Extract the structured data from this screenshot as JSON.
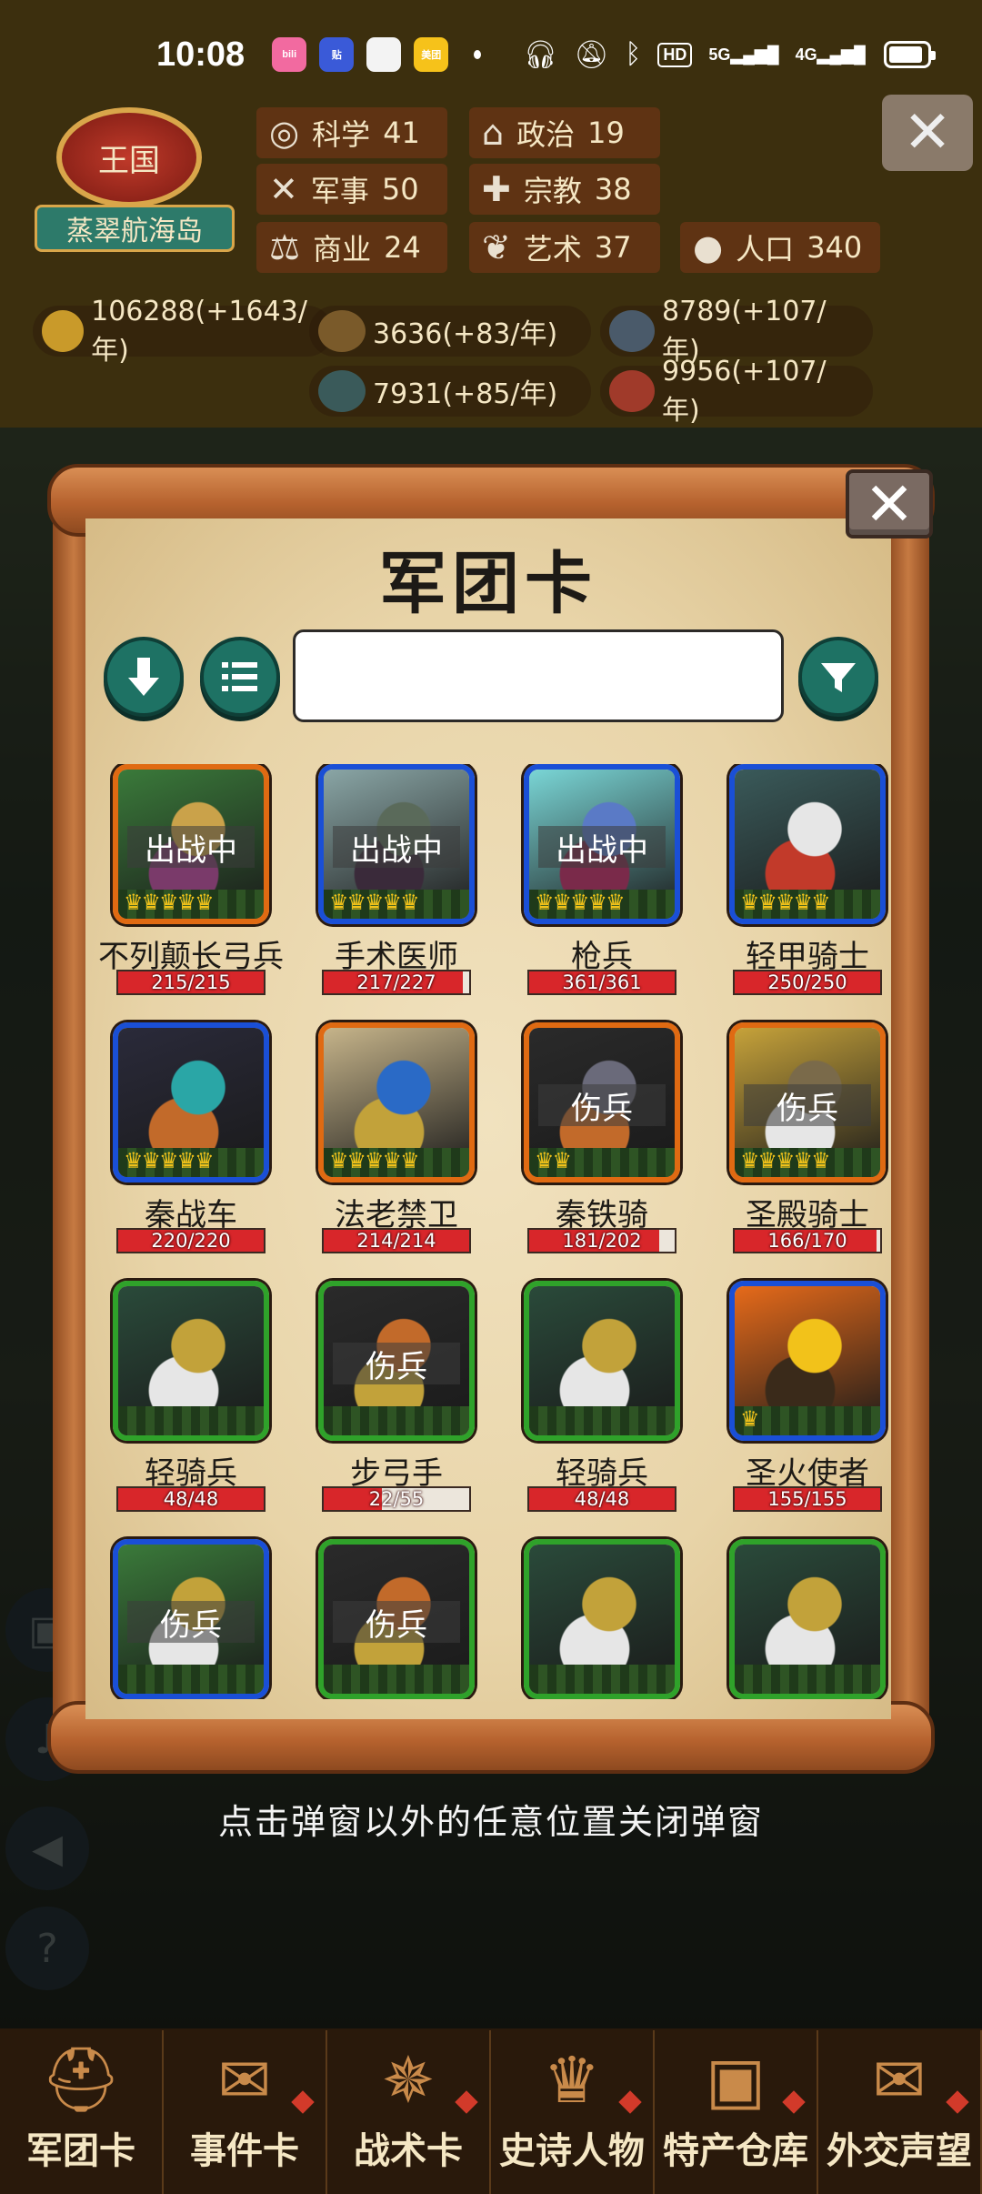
{
  "status_bar": {
    "time": "10:08",
    "apps": [
      {
        "name": "bilibili-app-icon",
        "label": "bili",
        "color": "#f26aa0"
      },
      {
        "name": "tieba-app-icon",
        "label": "贴",
        "color": "#3a5ad8"
      },
      {
        "name": "wallet-app-icon",
        "label": "",
        "color": "#f3f3f3"
      },
      {
        "name": "meituan-app-icon",
        "label": "美团",
        "color": "#f6c21a"
      }
    ],
    "hd": "HD",
    "sig_5g": "5G",
    "sig_4g": "4G"
  },
  "header": {
    "kingdom_emblem": "王国",
    "kingdom_name": "蒸翠航海岛",
    "stats": [
      {
        "icon": "planet-icon",
        "glyph": "◎",
        "label": "科学",
        "value": "41"
      },
      {
        "icon": "government-icon",
        "glyph": "⌂",
        "label": "政治",
        "value": "19"
      },
      {
        "icon": "crossed-swords-icon",
        "glyph": "✕",
        "label": "军事",
        "value": "50"
      },
      {
        "icon": "religion-icon",
        "glyph": "✚",
        "label": "宗教",
        "value": "38"
      },
      {
        "icon": "scales-icon",
        "glyph": "⚖",
        "label": "商业",
        "value": "24"
      },
      {
        "icon": "art-icon",
        "glyph": "❦",
        "label": "艺术",
        "value": "37"
      },
      {
        "icon": "population-icon",
        "glyph": "●",
        "label": "人口",
        "value": "340"
      }
    ],
    "resources": [
      {
        "icon": "gold-icon",
        "text": "106288(+1643/年)",
        "color": "#c99a2a"
      },
      {
        "icon": "wood-icon",
        "text": "3636(+83/年)",
        "color": "#7a5a2a"
      },
      {
        "icon": "iron-icon",
        "text": "8789(+107/年)",
        "color": "#4a5a6a"
      },
      {
        "icon": "stone-icon",
        "text": "7931(+85/年)",
        "color": "#3a5a5a"
      },
      {
        "icon": "meat-icon",
        "text": "9956(+107/年)",
        "color": "#a03a2a"
      }
    ]
  },
  "modal": {
    "title": "军团卡",
    "search_value": "",
    "cards": [
      {
        "name": "不列颠长弓兵",
        "hp": "215/215",
        "hp_ratio": 1.0,
        "frame": "orange",
        "state": "出战中",
        "crowns": 5,
        "art": [
          "#3a7a3a",
          "#caa24a",
          "#7a3a6a"
        ]
      },
      {
        "name": "手术医师",
        "hp": "217/227",
        "hp_ratio": 0.956,
        "frame": "blue",
        "state": "出战中",
        "crowns": 5,
        "art": [
          "#8aa6a6",
          "#5a6a5a",
          "#3a2a3a"
        ]
      },
      {
        "name": "枪兵",
        "hp": "361/361",
        "hp_ratio": 1.0,
        "frame": "blue",
        "state": "出战中",
        "crowns": 5,
        "art": [
          "#7ad6d6",
          "#5a7ac6",
          "#7a2a4a"
        ]
      },
      {
        "name": "轻甲骑士",
        "hp": "250/250",
        "hp_ratio": 1.0,
        "frame": "blue",
        "state": "",
        "crowns": 5,
        "art": [
          "#3a5a5a",
          "#e6e6e6",
          "#c23a2a"
        ]
      },
      {
        "name": "秦战车",
        "hp": "220/220",
        "hp_ratio": 1.0,
        "frame": "blue",
        "state": "",
        "crowns": 5,
        "art": [
          "#2a2a3a",
          "#2aa6a6",
          "#c26a2a"
        ]
      },
      {
        "name": "法老禁卫",
        "hp": "214/214",
        "hp_ratio": 1.0,
        "frame": "orange",
        "state": "",
        "crowns": 5,
        "art": [
          "#c6b48a",
          "#2a6ac6",
          "#c2a23a"
        ]
      },
      {
        "name": "秦铁骑",
        "hp": "181/202",
        "hp_ratio": 0.896,
        "frame": "orange",
        "state": "伤兵",
        "crowns": 2,
        "art": [
          "#2a2a2a",
          "#6a6a7a",
          "#c26a2a"
        ]
      },
      {
        "name": "圣殿骑士",
        "hp": "166/170",
        "hp_ratio": 0.976,
        "frame": "orange",
        "state": "伤兵",
        "crowns": 5,
        "art": [
          "#c6a23a",
          "#7a6a4a",
          "#e6e6e6"
        ]
      },
      {
        "name": "轻骑兵",
        "hp": "48/48",
        "hp_ratio": 1.0,
        "frame": "green",
        "state": "",
        "crowns": 0,
        "art": [
          "#2a4a3a",
          "#c2a23a",
          "#e6e6e6"
        ]
      },
      {
        "name": "步弓手",
        "hp": "22/55",
        "hp_ratio": 0.4,
        "frame": "green",
        "state": "伤兵",
        "crowns": 0,
        "art": [
          "#2a2a2a",
          "#c26a2a",
          "#c2a23a"
        ]
      },
      {
        "name": "轻骑兵",
        "hp": "48/48",
        "hp_ratio": 1.0,
        "frame": "green",
        "state": "",
        "crowns": 0,
        "art": [
          "#2a4a3a",
          "#c2a23a",
          "#e6e6e6"
        ]
      },
      {
        "name": "圣火使者",
        "hp": "155/155",
        "hp_ratio": 1.0,
        "frame": "blue",
        "state": "",
        "crowns": 1,
        "art": [
          "#e66a1a",
          "#f2c21a",
          "#3a2a1a"
        ]
      },
      {
        "name": "",
        "hp": "",
        "hp_ratio": 1.0,
        "frame": "blue",
        "state": "伤兵",
        "crowns": 0,
        "art": [
          "#3a7a3a",
          "#c2a23a",
          "#e6e6e6"
        ]
      },
      {
        "name": "",
        "hp": "",
        "hp_ratio": 1.0,
        "frame": "green",
        "state": "伤兵",
        "crowns": 0,
        "art": [
          "#2a2a2a",
          "#c26a2a",
          "#c2a23a"
        ]
      },
      {
        "name": "",
        "hp": "",
        "hp_ratio": 1.0,
        "frame": "green",
        "state": "",
        "crowns": 0,
        "art": [
          "#2a4a3a",
          "#c2a23a",
          "#e6e6e6"
        ]
      },
      {
        "name": "",
        "hp": "",
        "hp_ratio": 1.0,
        "frame": "green",
        "state": "",
        "crowns": 0,
        "art": [
          "#2a4a3a",
          "#c2a23a",
          "#e6e6e6"
        ]
      }
    ]
  },
  "hint": "点击弹窗以外的任意位置关闭弹窗",
  "bottom_nav": [
    {
      "label": "军团卡",
      "icon": "helmet-icon",
      "glyph": "⛑"
    },
    {
      "label": "事件卡",
      "icon": "event-icon",
      "glyph": "✉"
    },
    {
      "label": "战术卡",
      "icon": "tactics-icon",
      "glyph": "✵"
    },
    {
      "label": "史诗人物",
      "icon": "crown-icon",
      "glyph": "♛"
    },
    {
      "label": "特产仓库",
      "icon": "chest-icon",
      "glyph": "▣"
    },
    {
      "label": "外交声望",
      "icon": "letter-icon",
      "glyph": "✉"
    }
  ]
}
